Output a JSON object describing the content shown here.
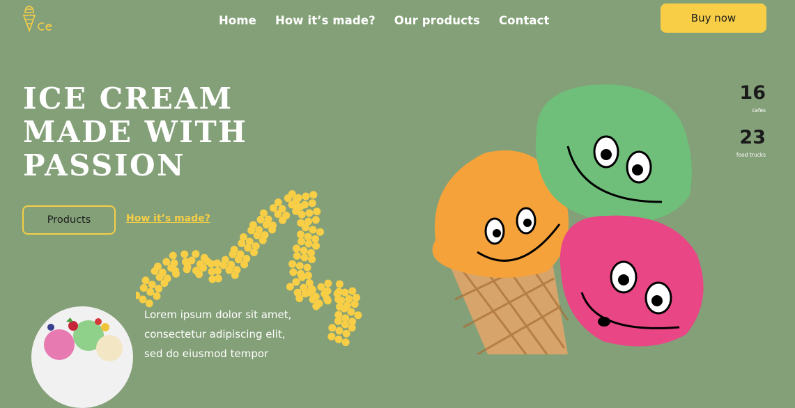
{
  "header": {
    "logo_icon": "ice-cream-cone-icon",
    "nav": [
      {
        "label": "Home"
      },
      {
        "label": "How it’s made?"
      },
      {
        "label": "Our products"
      },
      {
        "label": "Contact"
      }
    ],
    "buy_label": "Buy now"
  },
  "hero": {
    "headline": "ICE CREAM MADE WITH PASSION",
    "products_button": "Products",
    "how_link": "How it’s made?",
    "description": "Lorem ipsum dolor sit amet, consectetur adipiscing elit, sed do eiusmod tempor",
    "image": "three-smiling-ice-cream-scoops-cone"
  },
  "stats": [
    {
      "value": "16",
      "label": "cafes"
    },
    {
      "value": "23",
      "label": "food trucks"
    }
  ],
  "colors": {
    "background": "#84a078",
    "accent": "#f7ce46",
    "scoop_green": "#6fbf7b",
    "scoop_orange": "#f6a23a",
    "scoop_pink": "#e94686",
    "cone": "#d7a46b"
  }
}
